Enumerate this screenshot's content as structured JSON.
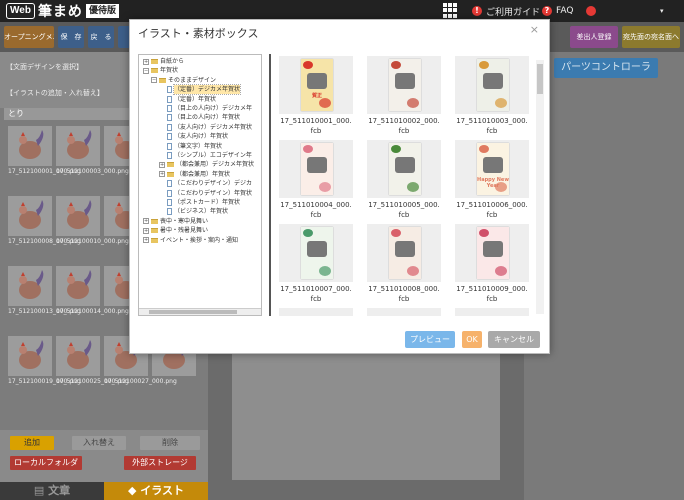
{
  "app": {
    "logo_web": "Web",
    "logo_main": "筆まめ",
    "logo_badge": "優待版"
  },
  "topnav": {
    "guide": "ご利用ガイド",
    "faq": "FAQ",
    "faq_icon": "?",
    "info_icon": "!"
  },
  "toolbar": {
    "opening": "オープニングメニュー",
    "btn2": "保　存",
    "btn3": "戻　る",
    "btn4": "",
    "r1": "差出人登録",
    "r2": "宛先面の宛名面へ"
  },
  "left": {
    "design_select": "【文面デザインを選択】",
    "illust_label": "【イラストの追加・入れ替え】",
    "list_header": "とり",
    "thumbs": [
      {
        "name": "17_512100001_000.png"
      },
      {
        "name": "17_512100003_000.png"
      },
      {
        "name": ""
      },
      {
        "name": ""
      },
      {
        "name": "17_512100008_000.png"
      },
      {
        "name": "17_512100010_000.png"
      },
      {
        "name": ""
      },
      {
        "name": ""
      },
      {
        "name": "17_512100013_000.png"
      },
      {
        "name": "17_512100014_000.png"
      },
      {
        "name": ""
      },
      {
        "name": ""
      },
      {
        "name": "17_512100019_000.png"
      },
      {
        "name": "17_512100025_000.png"
      },
      {
        "name": "17_512100027_000.png"
      },
      {
        "name": ""
      }
    ],
    "add": "追加",
    "replace": "入れ替え",
    "delete": "削除",
    "local": "ローカルフォルダ",
    "external": "外部ストレージ",
    "tab_text": "文章",
    "tab_illust": "イラスト"
  },
  "right": {
    "parts": "パーツコントローラ"
  },
  "modal": {
    "title": "イラスト・素材ボックス",
    "close": "×",
    "tree": [
      {
        "label": "自紙から",
        "type": "folder",
        "toggle": "+",
        "indent": 0
      },
      {
        "label": "年賀状",
        "type": "folder",
        "toggle": "−",
        "indent": 0
      },
      {
        "label": "そのままデザイン",
        "type": "folder",
        "toggle": "−",
        "indent": 1
      },
      {
        "label": "（定番）デジカメ年賀状",
        "type": "doc",
        "toggle": "",
        "indent": 2,
        "selected": true
      },
      {
        "label": "（定番）年賀状",
        "type": "doc",
        "toggle": "",
        "indent": 2
      },
      {
        "label": "（目上の人向け）デジカメ年",
        "type": "doc",
        "toggle": "",
        "indent": 2
      },
      {
        "label": "（目上の人向け）年賀状",
        "type": "doc",
        "toggle": "",
        "indent": 2
      },
      {
        "label": "（友人向け）デジカメ年賀状",
        "type": "doc",
        "toggle": "",
        "indent": 2
      },
      {
        "label": "（友人向け）年賀状",
        "type": "doc",
        "toggle": "",
        "indent": 2
      },
      {
        "label": "（筆文字）年賀状",
        "type": "doc",
        "toggle": "",
        "indent": 2
      },
      {
        "label": "（シンプル）エコデザイン年",
        "type": "doc",
        "toggle": "",
        "indent": 2
      },
      {
        "label": "（都会兼用）デジカメ年賀状",
        "type": "folder",
        "toggle": "+",
        "indent": 2
      },
      {
        "label": "（都会兼用）年賀状",
        "type": "folder",
        "toggle": "+",
        "indent": 2
      },
      {
        "label": "（こだわりデザイン）デジカ",
        "type": "doc",
        "toggle": "",
        "indent": 2
      },
      {
        "label": "（こだわりデザイン）年賀状",
        "type": "doc",
        "toggle": "",
        "indent": 2
      },
      {
        "label": "（ポストカード）年賀状",
        "type": "doc",
        "toggle": "",
        "indent": 2
      },
      {
        "label": "（ビジネス）年賀状",
        "type": "doc",
        "toggle": "",
        "indent": 2
      },
      {
        "label": "喪中・寒中見舞い",
        "type": "folder",
        "toggle": "+",
        "indent": 0
      },
      {
        "label": "暑中・残暑見舞い",
        "type": "folder",
        "toggle": "+",
        "indent": 0
      },
      {
        "label": "イベント・挨拶・案内・通知",
        "type": "folder",
        "toggle": "+",
        "indent": 0
      }
    ],
    "items": [
      {
        "name": "17_511010001_000.fcb",
        "style": "red",
        "text": "賀正"
      },
      {
        "name": "17_511010002_000.fcb",
        "style": "bird",
        "text": ""
      },
      {
        "name": "17_511010003_000.fcb",
        "style": "flower",
        "text": ""
      },
      {
        "name": "17_511010004_000.fcb",
        "style": "pink",
        "text": ""
      },
      {
        "name": "17_511010005_000.fcb",
        "style": "green",
        "text": ""
      },
      {
        "name": "17_511010006_000.fcb",
        "style": "hny",
        "text": "Happy New Year"
      },
      {
        "name": "17_511010007_000.fcb",
        "style": "pine",
        "text": ""
      },
      {
        "name": "17_511010008_000.fcb",
        "style": "grid",
        "text": ""
      },
      {
        "name": "17_511010009_000.fcb",
        "style": "circles",
        "text": ""
      }
    ],
    "preview": "プレビュー",
    "ok": "OK",
    "cancel": "キャンセル"
  },
  "colors": {
    "accent_orange": "#f0a030",
    "preview_blue": "#7ab7ea",
    "cancel_gray": "#a9a9a9",
    "ok_orange": "#f6b26b"
  }
}
